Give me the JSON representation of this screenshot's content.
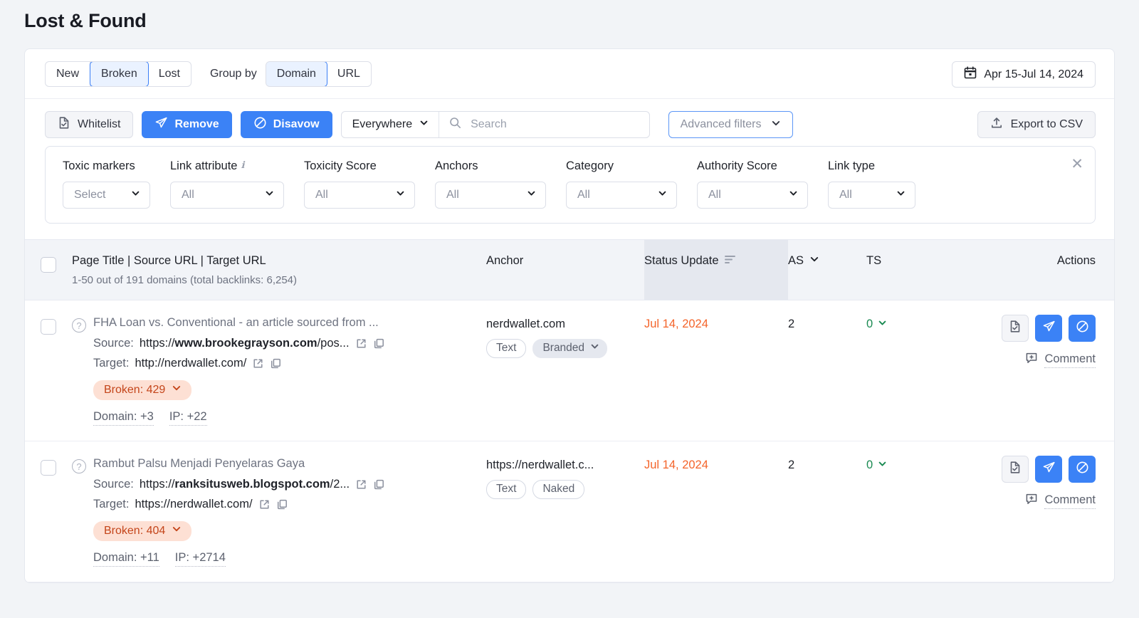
{
  "page": {
    "title": "Lost & Found"
  },
  "toolbar": {
    "status_tabs": [
      {
        "label": "New",
        "active": false
      },
      {
        "label": "Broken",
        "active": true
      },
      {
        "label": "Lost",
        "active": false
      }
    ],
    "group_by_label": "Group by",
    "group_tabs": [
      {
        "label": "Domain",
        "active": true
      },
      {
        "label": "URL",
        "active": false
      }
    ],
    "date_range": "Apr 15-Jul 14, 2024"
  },
  "actions": {
    "whitelist": "Whitelist",
    "remove": "Remove",
    "disavow": "Disavow",
    "scope_select": "Everywhere",
    "search_placeholder": "Search",
    "search_value": "",
    "advanced_filters": "Advanced filters",
    "export": "Export to CSV"
  },
  "filters": [
    {
      "label": "Toxic markers",
      "value": "Select",
      "info": false,
      "width": "w-123"
    },
    {
      "label": "Link attribute",
      "value": "All",
      "info": true,
      "width": "w-160"
    },
    {
      "label": "Toxicity Score",
      "value": "All",
      "info": false,
      "width": "w-156"
    },
    {
      "label": "Anchors",
      "value": "All",
      "info": false,
      "width": "w-156"
    },
    {
      "label": "Category",
      "value": "All",
      "info": false,
      "width": "w-156"
    },
    {
      "label": "Authority Score",
      "value": "All",
      "info": false,
      "width": "w-156"
    },
    {
      "label": "Link type",
      "value": "All",
      "info": false,
      "width": "w-123"
    }
  ],
  "table": {
    "headers": {
      "title": "Page Title | Source URL | Target URL",
      "subtitle": "1-50 out of 191 domains (total backlinks: 6,254)",
      "anchor": "Anchor",
      "status": "Status Update",
      "as": "AS",
      "ts": "TS",
      "actions": "Actions"
    },
    "rows": [
      {
        "title": "FHA Loan vs. Conventional - an article sourced from ...",
        "source_label": "Source:",
        "source_prefix": "https://",
        "source_domain": "www.brookegrayson.com",
        "source_suffix": "/pos...",
        "target_label": "Target:",
        "target_url": "http://nerdwallet.com/",
        "broken": "Broken: 429",
        "domain_ref": "Domain: +3",
        "ip_ref": "IP: +22",
        "anchor": "nerdwallet.com",
        "tags": [
          {
            "label": "Text",
            "filled": false,
            "chevron": false
          },
          {
            "label": "Branded",
            "filled": true,
            "chevron": true
          }
        ],
        "status_update": "Jul 14, 2024",
        "as": "2",
        "ts": "0",
        "comment": "Comment"
      },
      {
        "title": "Rambut Palsu Menjadi Penyelaras Gaya",
        "source_label": "Source:",
        "source_prefix": "https://",
        "source_domain": "ranksitusweb.blogspot.com",
        "source_suffix": "/2...",
        "target_label": "Target:",
        "target_url": "https://nerdwallet.com/",
        "broken": "Broken: 404",
        "domain_ref": "Domain: +11",
        "ip_ref": "IP: +2714",
        "anchor": "https://nerdwallet.c...",
        "tags": [
          {
            "label": "Text",
            "filled": false,
            "chevron": false
          },
          {
            "label": "Naked",
            "filled": false,
            "chevron": false
          }
        ],
        "status_update": "Jul 14, 2024",
        "as": "2",
        "ts": "0",
        "comment": "Comment"
      }
    ]
  },
  "icons": {
    "calendar": "calendar-icon",
    "whitelist": "document-check-icon",
    "remove": "paper-plane-icon",
    "disavow": "no-entry-icon",
    "search": "search-icon",
    "export": "upload-icon",
    "close": "close-icon",
    "sort": "sort-icon",
    "chevron": "chevron-down-icon",
    "external": "external-link-icon",
    "copy": "copy-icon",
    "comment": "add-comment-icon",
    "info": "info-icon",
    "help": "help-circle-icon"
  },
  "colors": {
    "accent": "#3b82f6",
    "broken_text": "#c4451a",
    "broken_bg": "#fde0d4",
    "status_date": "#f4642a",
    "ts_green": "#1a8a52"
  }
}
